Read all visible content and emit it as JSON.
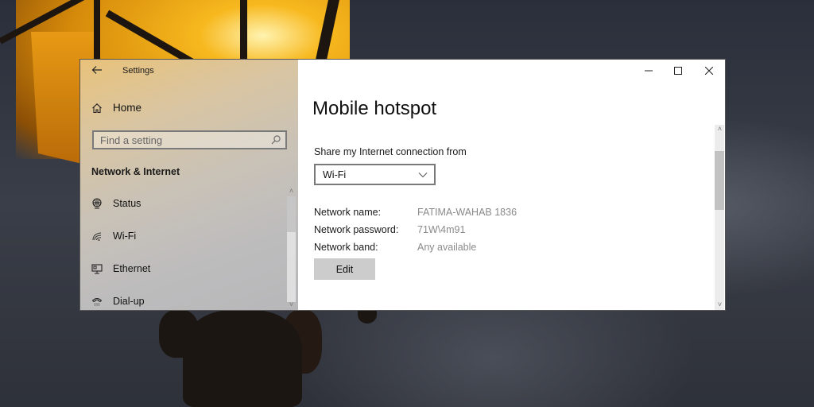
{
  "window": {
    "app_title": "Settings",
    "back_icon": "back-arrow-icon",
    "controls": {
      "minimize": "minimize-icon",
      "maximize": "maximize-icon",
      "close": "close-icon"
    }
  },
  "sidebar": {
    "home_label": "Home",
    "home_icon": "home-icon",
    "search": {
      "placeholder": "Find a setting",
      "value": "",
      "icon": "search-icon"
    },
    "section_title": "Network & Internet",
    "items": [
      {
        "label": "Status",
        "icon": "globe-status-icon"
      },
      {
        "label": "Wi-Fi",
        "icon": "wifi-icon"
      },
      {
        "label": "Ethernet",
        "icon": "ethernet-icon"
      },
      {
        "label": "Dial-up",
        "icon": "dialup-phone-icon"
      }
    ]
  },
  "main": {
    "page_title": "Mobile hotspot",
    "share_label": "Share my Internet connection from",
    "share_dropdown": {
      "selected": "Wi-Fi"
    },
    "properties": [
      {
        "label": "Network name:",
        "value": "FATIMA-WAHAB 1836"
      },
      {
        "label": "Network password:",
        "value": "71W\\4m91"
      },
      {
        "label": "Network band:",
        "value": "Any available"
      }
    ],
    "edit_label": "Edit"
  },
  "colors": {
    "window_bg": "#ffffff",
    "edit_button_bg": "#cccccc",
    "value_text": "#8a8a8a",
    "desktop_bg": "#2e3139",
    "lamp_glow": "#f7b81e"
  }
}
